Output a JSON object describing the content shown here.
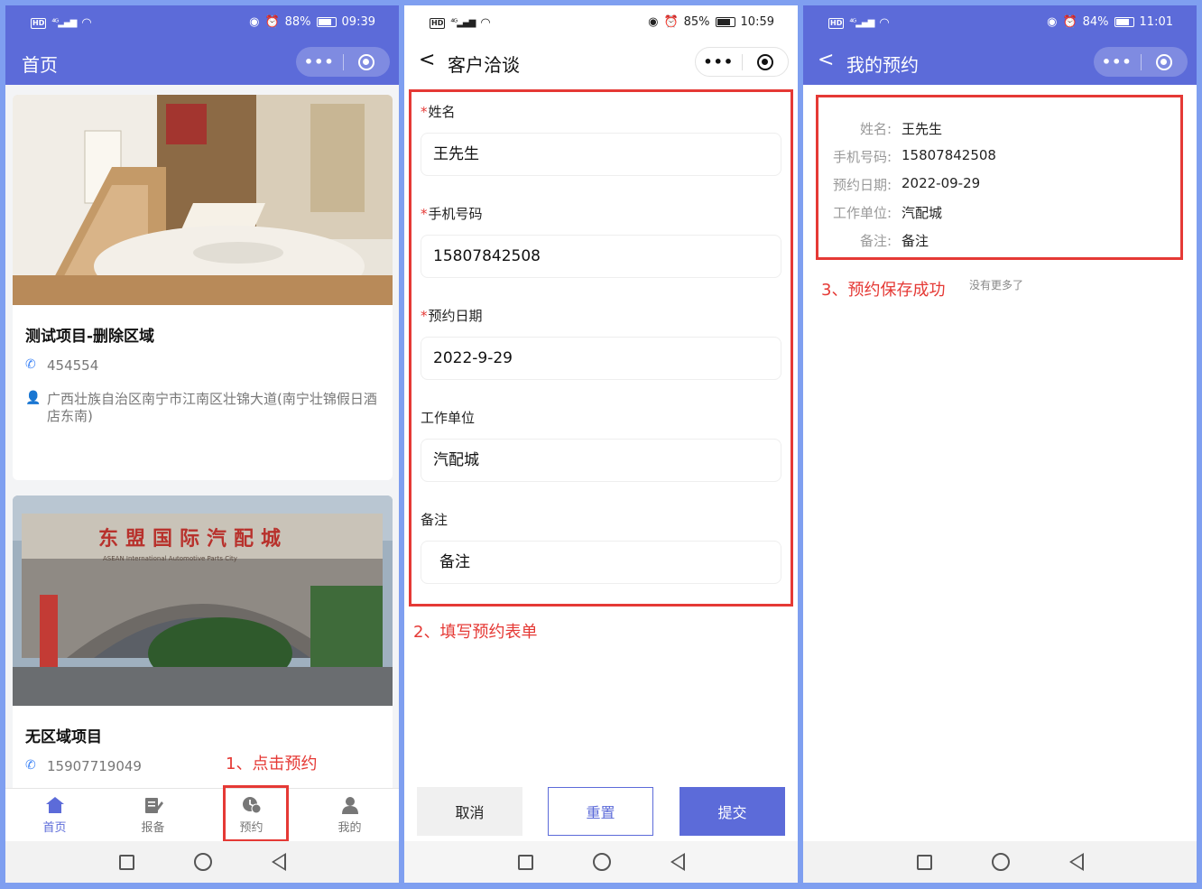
{
  "phone1": {
    "status": {
      "battery": "88%",
      "time": "09:39"
    },
    "nav": {
      "title": "首页"
    },
    "cards": [
      {
        "title": "测试项目-删除区域",
        "phone": "454554",
        "address": "广西壮族自治区南宁市江南区壮锦大道(南宁壮锦假日酒店东南)"
      },
      {
        "title": "无区域项目",
        "phone": "15907719049",
        "sign_text": "东盟国际汽配城",
        "sign_subtext": "ASEAN International Automotive Parts City"
      }
    ],
    "tabs": [
      {
        "label": "首页",
        "icon": "home-icon"
      },
      {
        "label": "报备",
        "icon": "edit-icon"
      },
      {
        "label": "预约",
        "icon": "appointment-icon"
      },
      {
        "label": "我的",
        "icon": "user-icon"
      }
    ],
    "annotation": "1、点击预约"
  },
  "phone2": {
    "status": {
      "battery": "85%",
      "time": "10:59"
    },
    "nav": {
      "back": "<",
      "title": "客户洽谈"
    },
    "form": {
      "name": {
        "label": "姓名",
        "value": "王先生",
        "required": "*"
      },
      "phone": {
        "label": "手机号码",
        "value": "15807842508",
        "required": "*"
      },
      "date": {
        "label": "预约日期",
        "value": "2022-9-29",
        "required": "*"
      },
      "company": {
        "label": "工作单位",
        "value": "汽配城"
      },
      "remark": {
        "label": "备注",
        "value": "备注"
      }
    },
    "buttons": {
      "cancel": "取消",
      "reset": "重置",
      "submit": "提交"
    },
    "annotation": "2、填写预约表单"
  },
  "phone3": {
    "status": {
      "battery": "84%",
      "time": "11:01"
    },
    "nav": {
      "back": "<",
      "title": "我的预约"
    },
    "record": [
      {
        "key": "姓名:",
        "value": "王先生"
      },
      {
        "key": "手机号码:",
        "value": "15807842508"
      },
      {
        "key": "预约日期:",
        "value": "2022-09-29"
      },
      {
        "key": "工作单位:",
        "value": "汽配城"
      },
      {
        "key": "备注:",
        "value": "备注"
      }
    ],
    "no_more": "没有更多了",
    "annotation": "3、预约保存成功"
  },
  "colors": {
    "primary": "#5c6bd9",
    "annotation_red": "#e53935",
    "background_frame": "#7f9ff0"
  }
}
